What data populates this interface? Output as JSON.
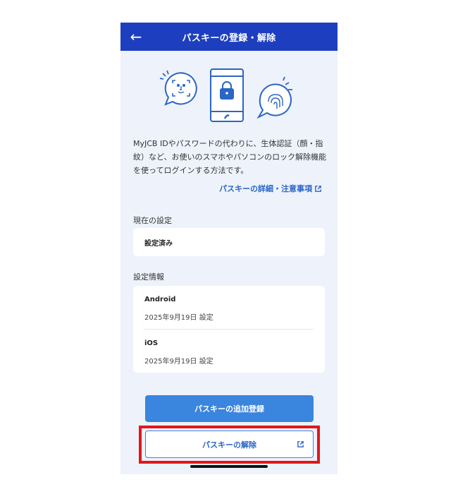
{
  "header": {
    "title": "パスキーの登録・解除",
    "back_icon": "arrow-left-icon"
  },
  "illustration": {
    "icons": [
      "face-recognition-icon",
      "smartphone-lock-icon",
      "fingerprint-icon"
    ],
    "accent_color": "#2a66c4"
  },
  "description": "MyJCB IDやパスワードの代わりに、生体認証（顔・指紋）など、お使いのスマホやパソコンのロック解除機能を使ってログインする方法です。",
  "detail_link": {
    "label": "パスキーの詳細・注意事項",
    "icon": "external-link-icon"
  },
  "current_setting": {
    "label": "現在の設定",
    "value": "設定済み"
  },
  "setting_info": {
    "label": "設定情報",
    "devices": [
      {
        "name": "Android",
        "date": "2025年9月19日 設定"
      },
      {
        "name": "iOS",
        "date": "2025年9月19日 設定"
      }
    ]
  },
  "buttons": {
    "add_label": "パスキーの追加登録",
    "remove_label": "パスキーの解除",
    "remove_icon": "external-link-icon"
  },
  "colors": {
    "header": "#1d3fbf",
    "primary": "#3a85de",
    "background": "#eef2fb",
    "highlight": "#e3161b"
  }
}
